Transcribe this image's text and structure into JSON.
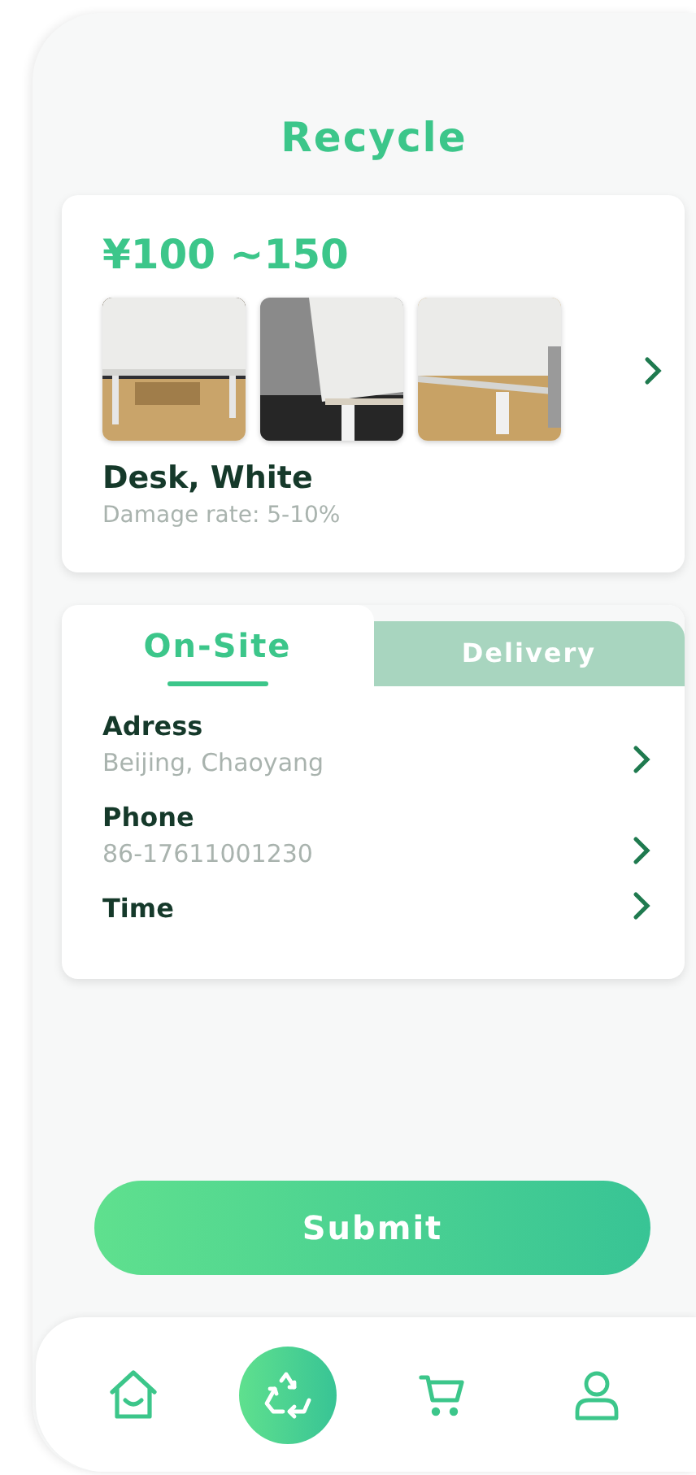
{
  "header": {
    "title": "Recycle"
  },
  "item": {
    "price": "¥100 ~150",
    "name": "Desk, White",
    "damage": "Damage rate: 5-10%"
  },
  "tabs": [
    {
      "label": "On-Site",
      "selected": true
    },
    {
      "label": "Delivery",
      "selected": false
    }
  ],
  "fields": [
    {
      "label": "Adress",
      "value": "Beijing, Chaoyang"
    },
    {
      "label": "Phone",
      "value": "86-17611001230"
    },
    {
      "label": "Time"
    }
  ],
  "submit": "Submit",
  "bottom_nav": [
    {
      "kind": "home",
      "selected": false
    },
    {
      "kind": "recycle",
      "selected": true
    },
    {
      "kind": "cart",
      "selected": false
    },
    {
      "kind": "profile",
      "selected": false
    }
  ]
}
